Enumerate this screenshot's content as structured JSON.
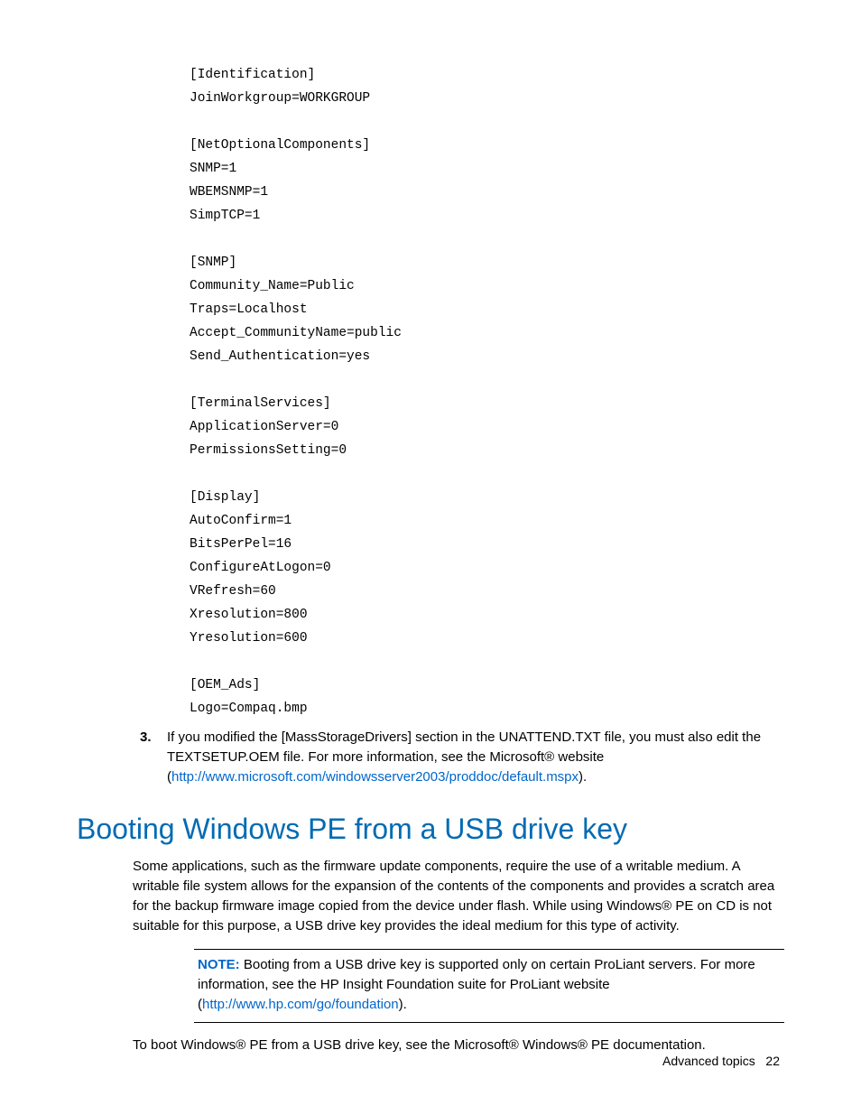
{
  "code_lines": "[Identification]\nJoinWorkgroup=WORKGROUP\n\n[NetOptionalComponents]\nSNMP=1\nWBEMSNMP=1\nSimpTCP=1\n\n[SNMP]\nCommunity_Name=Public\nTraps=Localhost\nAccept_CommunityName=public\nSend_Authentication=yes\n\n[TerminalServices]\nApplicationServer=0\nPermissionsSetting=0\n\n[Display]\nAutoConfirm=1\nBitsPerPel=16\nConfigureAtLogon=0\nVRefresh=60\nXresolution=800\nYresolution=600\n\n[OEM_Ads]\nLogo=Compaq.bmp",
  "step": {
    "num": "3.",
    "text_a": "If you modified the [MassStorageDrivers] section in the UNATTEND.TXT file, you must also edit the TEXTSETUP.OEM file. For more information, see the Microsoft® website (",
    "link": "http://www.microsoft.com/windowsserver2003/proddoc/default.mspx",
    "text_b": ")."
  },
  "heading": "Booting Windows PE from a USB drive key",
  "para1": "Some applications, such as the firmware update components, require the use of a writable medium. A writable file system allows for the expansion of the contents of the components and provides a scratch area for the backup firmware image copied from the device under flash. While using Windows® PE on CD is not suitable for this purpose, a USB drive key provides the ideal medium for this type of activity.",
  "note": {
    "label": "NOTE:",
    "text_a": "Booting from a USB drive key is supported only on certain ProLiant servers. For more information, see the HP Insight Foundation suite for ProLiant website (",
    "link": "http://www.hp.com/go/foundation",
    "text_b": ")."
  },
  "para2": "To boot Windows® PE from a USB drive key, see the Microsoft® Windows® PE documentation.",
  "footer": {
    "section": "Advanced topics",
    "page": "22"
  }
}
